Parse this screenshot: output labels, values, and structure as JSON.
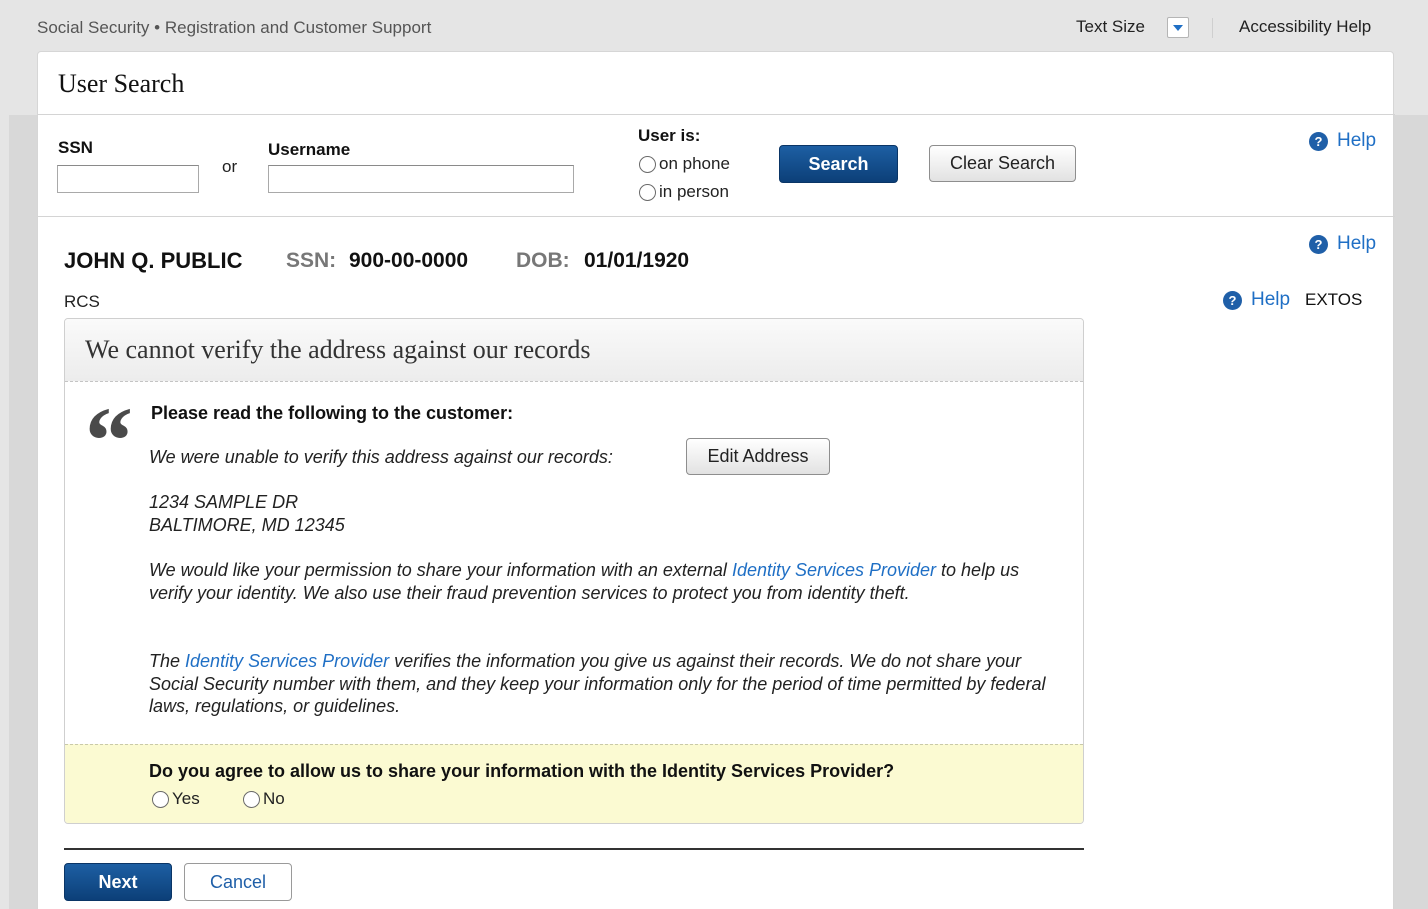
{
  "topbar": {
    "site_title": "Social Security • Registration and Customer Support",
    "text_size_label": "Text Size",
    "accessibility_help": "Accessibility Help"
  },
  "page": {
    "title": "User Search"
  },
  "search": {
    "ssn_label": "SSN",
    "ssn_value": "",
    "or_label": "or",
    "username_label": "Username",
    "username_value": "",
    "user_is_label": "User is:",
    "on_phone_label": "on phone",
    "in_person_label": "in person",
    "search_button": "Search",
    "clear_button": "Clear Search",
    "help_label": "Help"
  },
  "customer": {
    "name": "JOHN Q. PUBLIC",
    "ssn_label": "SSN:",
    "ssn_value": "900-00-0000",
    "dob_label": "DOB:",
    "dob_value": "01/01/1920",
    "help_label": "Help",
    "rcs_label": "RCS",
    "extos_help_label": "Help",
    "extos_label": "EXTOS"
  },
  "message": {
    "title": "We cannot verify the address against our records",
    "quote_mark": "“",
    "read_heading": "Please read the following to the customer:",
    "unable_text": "We were unable to verify this address against our records:",
    "edit_address_button": "Edit Address",
    "address_line1": "1234 SAMPLE DR",
    "address_line2": "BALTIMORE, MD 12345",
    "para1_a": "We would like your permission to share your information with an external ",
    "para1_link": "Identity Services Provider",
    "para1_b": " to help us verify your identity. We also use their fraud prevention services to protect you from identity theft.",
    "para2_a": "The ",
    "para2_link": "Identity Services Provider",
    "para2_b": " verifies the information you give us against their records. We do not share your Social Security number with them, and they keep your information only for the period of time permitted by federal laws, regulations, or guidelines.",
    "agree_question": "Do you agree to allow us to share your information with the Identity Services Provider?",
    "yes_label": "Yes",
    "no_label": "No"
  },
  "actions": {
    "next_button": "Next",
    "cancel_button": "Cancel"
  },
  "colors": {
    "primary_button": "#0c3f78",
    "link": "#1f6fc5",
    "notice_background": "#fbfad2"
  }
}
